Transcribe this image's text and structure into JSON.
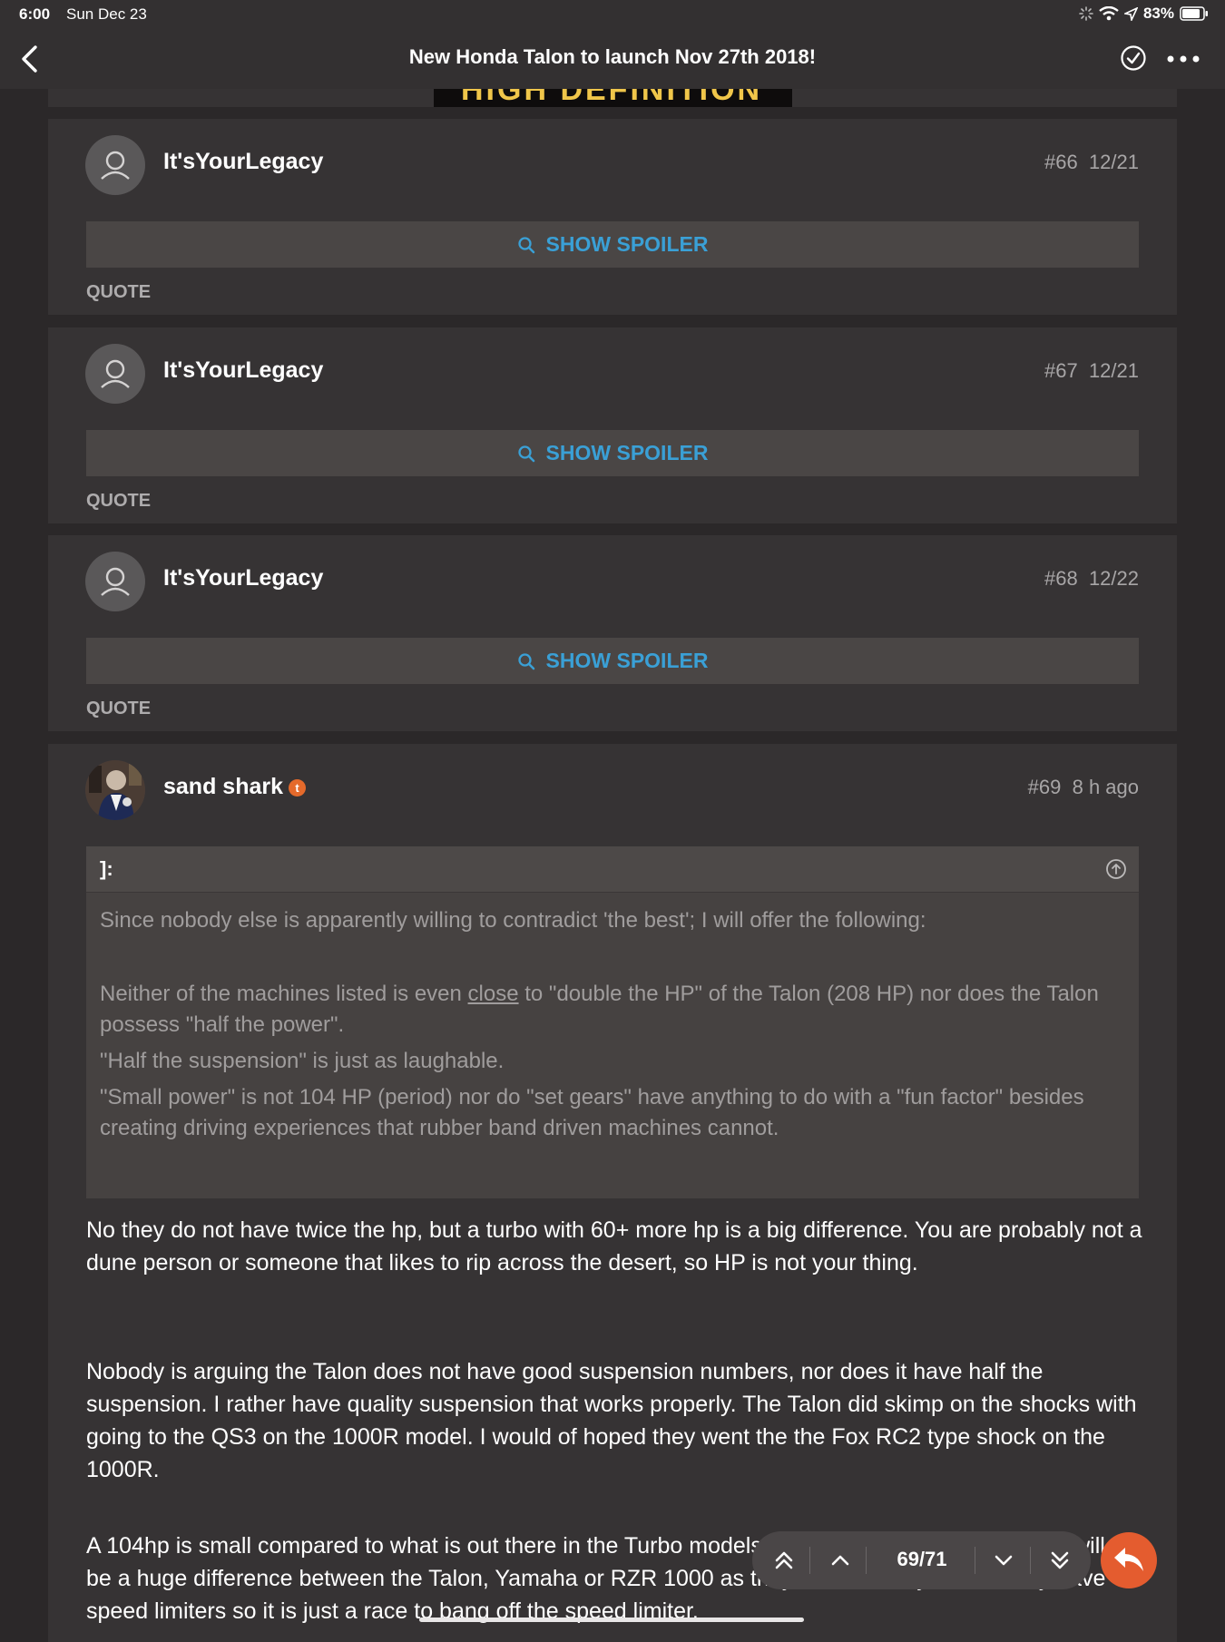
{
  "status_bar": {
    "time": "6:00",
    "date": "Sun Dec 23",
    "battery": "83%"
  },
  "nav": {
    "title": "New Honda Talon to launch Nov 27th 2018!"
  },
  "prev_image_text": "HIGH DEFINITION",
  "posts": [
    {
      "username": "It'sYourLegacy",
      "number": "#66",
      "date": "12/21",
      "spoiler_label": "SHOW SPOILER",
      "quote_label": "QUOTE"
    },
    {
      "username": "It'sYourLegacy",
      "number": "#67",
      "date": "12/21",
      "spoiler_label": "SHOW SPOILER",
      "quote_label": "QUOTE"
    },
    {
      "username": "It'sYourLegacy",
      "number": "#68",
      "date": "12/22",
      "spoiler_label": "SHOW SPOILER",
      "quote_label": "QUOTE"
    }
  ],
  "post69": {
    "username": "sand shark",
    "badge": "t",
    "number": "#69",
    "time": "8 h ago",
    "quote": {
      "author": "]:",
      "line1": "Since nobody else is apparently willing to contradict 'the best'; I will offer the following:",
      "line2_pre": "Neither of the machines listed is even ",
      "line2_underlined": "close",
      "line2_post": " to \"double the HP\" of the Talon (208 HP) nor does the Talon possess \"half the power\".",
      "line3": "\"Half the suspension\" is just as laughable.",
      "line4": "\"Small power\" is not 104 HP (period) nor do \"set gears\" have anything to do with a \"fun factor\" besides creating driving experiences that rubber band driven machines cannot."
    },
    "paragraph1": "No they do not have twice the hp, but a turbo with 60+ more hp is a big difference. You are probably not a dune person or someone that likes to rip across the desert, so HP is not your thing.",
    "paragraph2": "Nobody is arguing the Talon does not have good suspension numbers, nor does it have half the suspension. I rather have quality suspension that works properly. The Talon did skimp on the shocks with going to the QS3 on the 1000R model. I would of hoped they went the the Fox RC2 type shock on the 1000R.",
    "paragraph3": "A 104hp is small compared to what is out there in the Turbo models. In the non turbo market there will not be a huge difference between the Talon, Yamaha or RZR 1000 as they are relatively close. They have speed limiters so it is just a race to bang off the speed limiter."
  },
  "pager": {
    "count": "69/71"
  }
}
